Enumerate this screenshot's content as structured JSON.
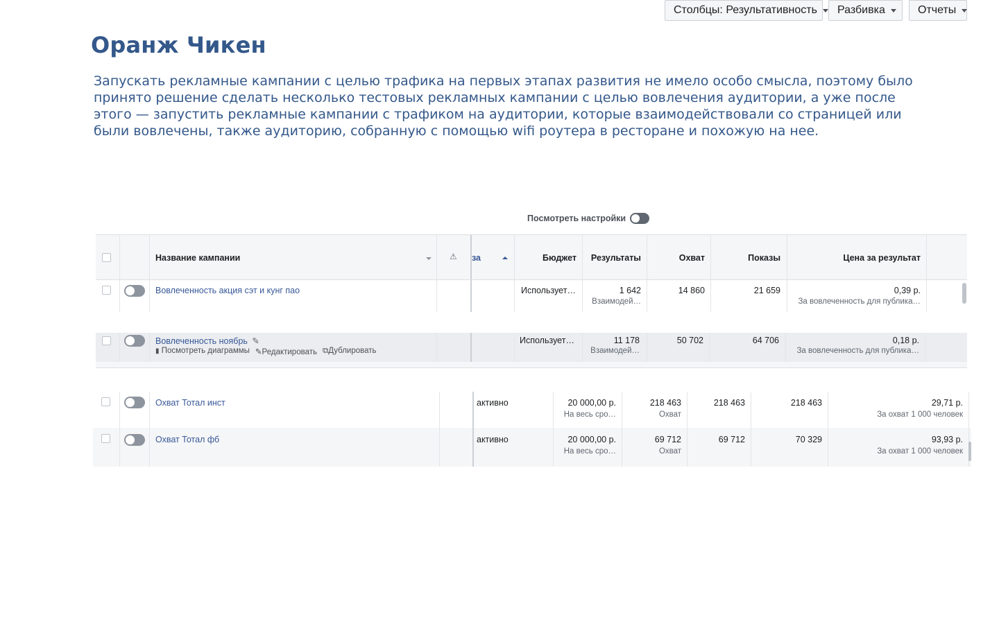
{
  "page": {
    "title": "Оранж Чикен",
    "description": "Запускать рекламные кампании с целью трафика на первых этапах развития не имело особо смысла, поэтому было принято решение сделать несколько тестовых рекламных кампании с целью вовлечения аудитории, а уже после этого — запустить рекламные кампании с трафиком на аудитории, которые взаимодействовали со страницей или были вовлечены, также аудиторию, собранную с помощью wifi роутера в ресторане и похожую на нее."
  },
  "toolbar": {
    "view_settings_label": "Посмотреть настройки",
    "columns_prefix": "Столбцы:",
    "columns_value": "Результативность",
    "breakdown_label": "Разбивка",
    "reports_label": "Отчеты"
  },
  "table1": {
    "headers": {
      "campaign_name": "Название кампании",
      "partial_col": "за",
      "budget": "Бюджет",
      "results": "Результаты",
      "reach": "Охват",
      "impressions": "Показы",
      "cost_per_result": "Цена за результат"
    },
    "rows": [
      {
        "name": "Вовлеченность акция сэт и кунг пао",
        "budget": "Использует…",
        "results": "1 642",
        "results_sub": "Взаимодей…",
        "reach": "14 860",
        "impressions": "21 659",
        "cost": "0,39 р.",
        "cost_sub": "За вовлеченность для публика…"
      },
      {
        "name": "Вовлеченность ноябрь",
        "budget": "Использует…",
        "results": "11 178",
        "results_sub": "Взаимодей…",
        "reach": "50 702",
        "impressions": "64 706",
        "cost": "0,18 р.",
        "cost_sub": "За вовлеченность для публика…",
        "actions": [
          "Посмотреть диаграммы",
          "Редактировать",
          "Дублировать"
        ]
      }
    ]
  },
  "table2": {
    "rows": [
      {
        "name": "Охват Тотал инст",
        "status": "активно",
        "budget": "20 000,00 р.",
        "budget_sub": "На весь сро…",
        "results": "218 463",
        "results_sub": "Охват",
        "reach": "218 463",
        "impressions": "218 463",
        "cost": "29,71 р.",
        "cost_sub": "За охват 1 000 человек"
      },
      {
        "name": "Охват Тотал фб",
        "status": "активно",
        "budget": "20 000,00 р.",
        "budget_sub": "На весь сро…",
        "results": "69 712",
        "results_sub": "Охват",
        "reach": "69 712",
        "impressions": "70 329",
        "cost": "93,93 р.",
        "cost_sub": "За охват 1 000 человек"
      }
    ]
  },
  "colors": {
    "heading": "#34588a",
    "link": "#385898",
    "hover_row": "#ebedf0"
  }
}
